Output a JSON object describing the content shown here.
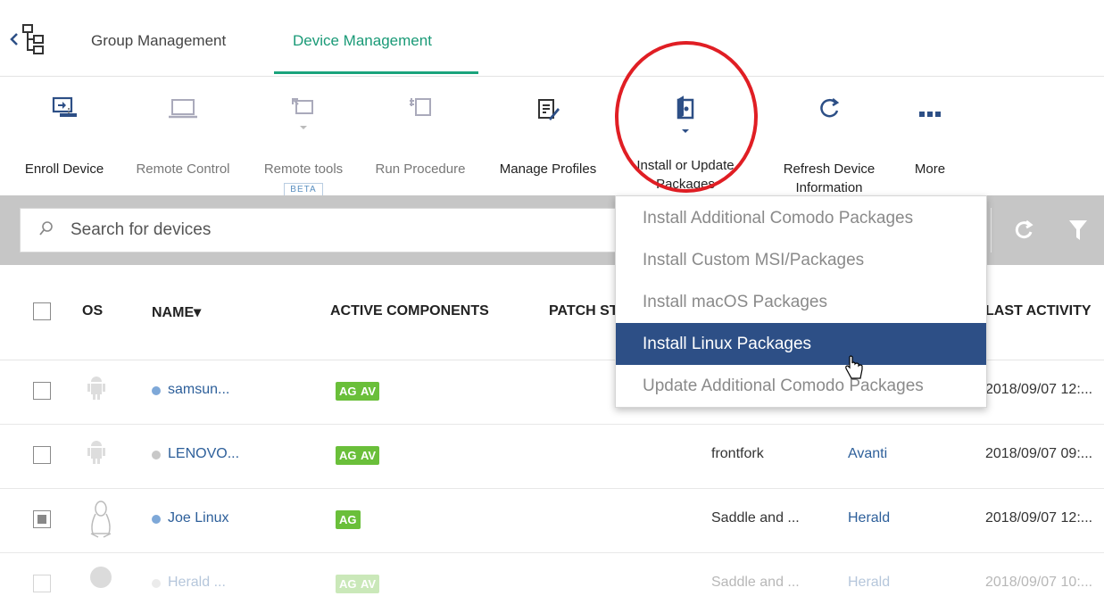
{
  "tabs": {
    "group_management": "Group Management",
    "device_management": "Device Management"
  },
  "toolbar": {
    "enroll_device": "Enroll Device",
    "remote_control": "Remote Control",
    "remote_tools": "Remote tools",
    "beta": "BETA",
    "run_procedure": "Run Procedure",
    "manage_profiles": "Manage Profiles",
    "install_update_line1": "Install or Update",
    "install_update_line2": "Packages",
    "refresh_line1": "Refresh Device",
    "refresh_line2": "Information",
    "more": "More"
  },
  "search": {
    "placeholder": "Search for devices"
  },
  "table": {
    "headers": {
      "os": "OS",
      "name": "NAME",
      "name_sort": "▾",
      "active_components": "ACTIVE COMPONENTS",
      "patch_status": "PATCH ST",
      "last_activity": "LAST ACTIVITY"
    },
    "rows": [
      {
        "name": "samsun...",
        "badges": [
          "AG",
          "AV"
        ],
        "company": "",
        "customer": "",
        "last_activity": "2018/09/07 12:..."
      },
      {
        "name": "LENOVO...",
        "badges": [
          "AG",
          "AV"
        ],
        "company": "frontfork",
        "customer": "Avanti",
        "last_activity": "2018/09/07 09:..."
      },
      {
        "name": "Joe Linux",
        "badges": [
          "AG"
        ],
        "company": "Saddle and ...",
        "customer": "Herald",
        "last_activity": "2018/09/07 12:..."
      },
      {
        "name": "Herald ...",
        "badges": [
          "AG",
          "AV"
        ],
        "company": "Saddle and ...",
        "customer": "Herald",
        "last_activity": "2018/09/07 10:..."
      }
    ]
  },
  "dropdown": {
    "items": [
      "Install Additional Comodo Packages",
      "Install Custom MSI/Packages",
      "Install macOS Packages",
      "Install Linux Packages",
      "Update Additional Comodo Packages"
    ],
    "selected": "Install Linux Packages"
  },
  "colors": {
    "accent_green": "#1aa37c",
    "badge_green": "#6abf3a",
    "dropdown_highlight": "#2d4f86",
    "annotation_red": "#e01e24",
    "link_blue": "#2d5f9a"
  },
  "icons": [
    "back-tree-icon",
    "enroll-device-icon",
    "laptop-icon",
    "remote-tools-icon",
    "run-procedure-icon",
    "manage-profiles-icon",
    "install-package-icon",
    "refresh-icon",
    "more-dots-icon",
    "search-icon",
    "filter-icon",
    "android-icon",
    "linux-icon",
    "hand-cursor-icon"
  ]
}
